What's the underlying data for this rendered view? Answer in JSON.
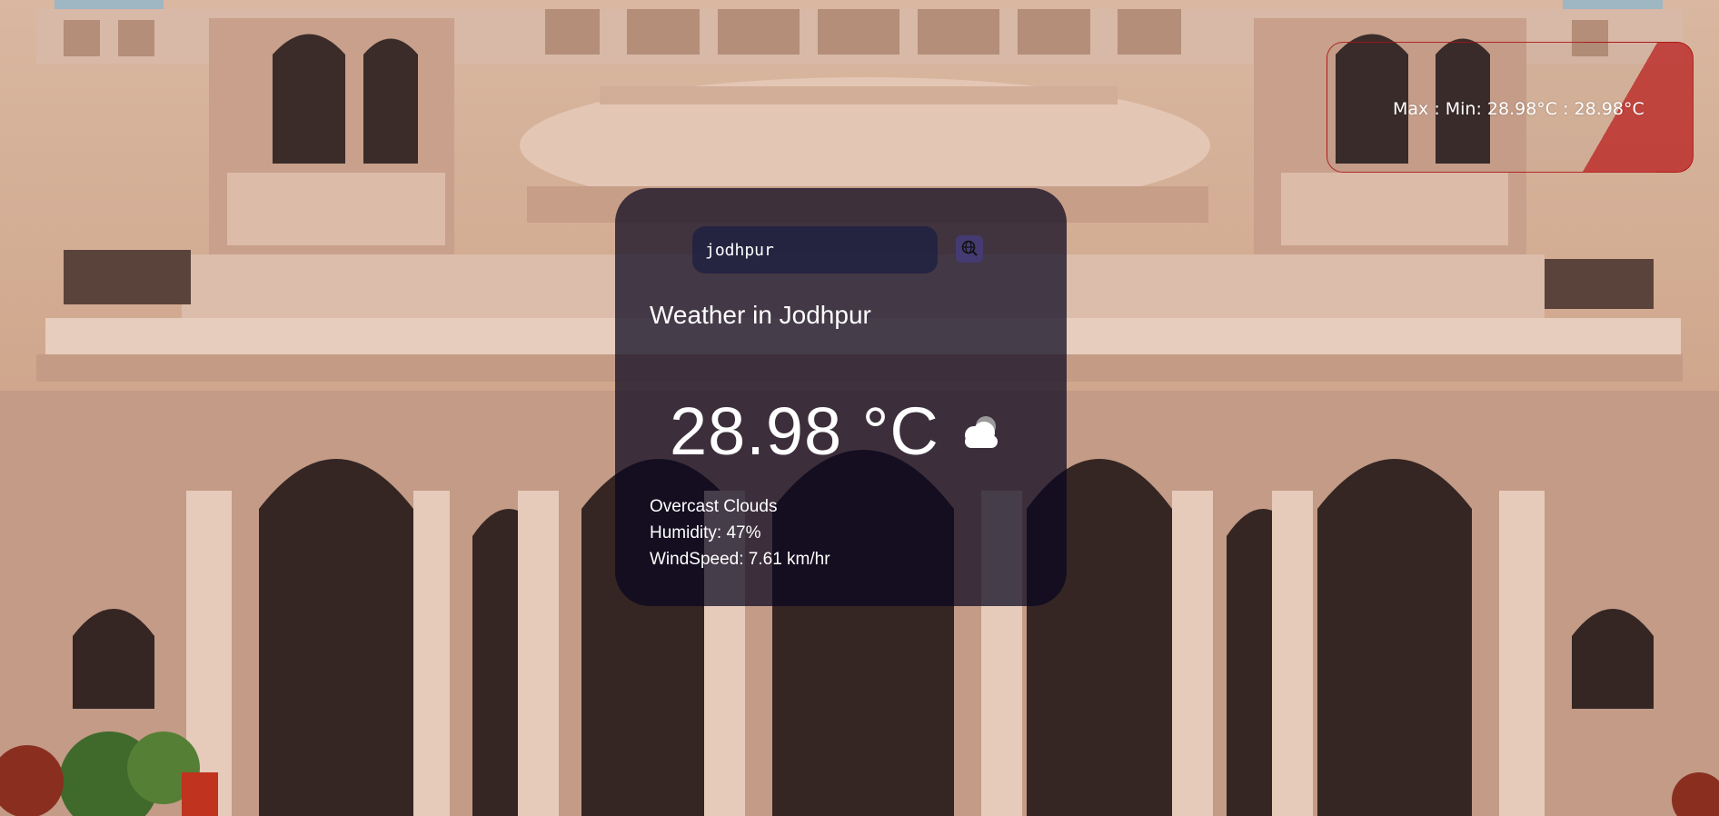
{
  "background": {
    "description_icon": "palace-background-image"
  },
  "minmax": {
    "text": "Max : Min: 28.98°C : 28.98°C"
  },
  "search": {
    "value": "jodhpur",
    "placeholder": "",
    "button_icon": "globe-search-icon"
  },
  "weather": {
    "title": "Weather in Jodhpur",
    "temperature": "28.98 °C",
    "icon": "cloud-icon",
    "description": "Overcast Clouds",
    "humidity": "Humidity: 47%",
    "wind": "WindSpeed: 7.61 km/hr"
  },
  "colors": {
    "card_bg": "#08061e",
    "minmax_accent": "#b91e1e",
    "text": "#ffffff"
  }
}
